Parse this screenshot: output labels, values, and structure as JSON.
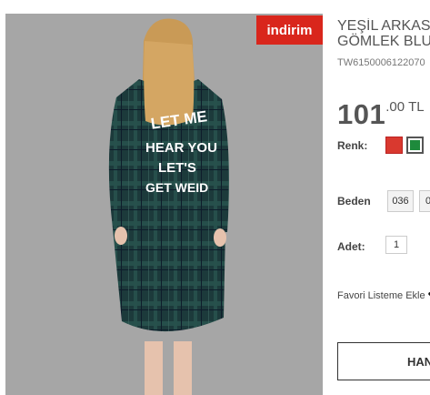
{
  "product": {
    "badge": "indirim",
    "title_line1": "YEŞİL ARKASI",
    "title_line2": "GÖMLEK BLU",
    "sku": "TW6150006122070",
    "price_int": "101",
    "price_dec": ".00",
    "currency": "TL",
    "back_print": [
      "LET ME",
      "HEAR YOU",
      "LET'S",
      "GET WEID"
    ]
  },
  "options": {
    "color_label": "Renk:",
    "colors": [
      {
        "name": "red-swatch",
        "hex": "#d9392f",
        "selected": false
      },
      {
        "name": "green-swatch",
        "hex": "#1e8a3c",
        "selected": true
      }
    ],
    "size_label": "Beden",
    "sizes": [
      "036",
      "0"
    ],
    "qty_label": "Adet:",
    "qty_value": "1"
  },
  "actions": {
    "favorite_label": "Favori Listeme Ekle",
    "cart_label": "HAN"
  },
  "colors": {
    "badge_bg": "#d9261c",
    "photo_bg": "#a6a6a6",
    "dress": "#1d3b3a"
  }
}
